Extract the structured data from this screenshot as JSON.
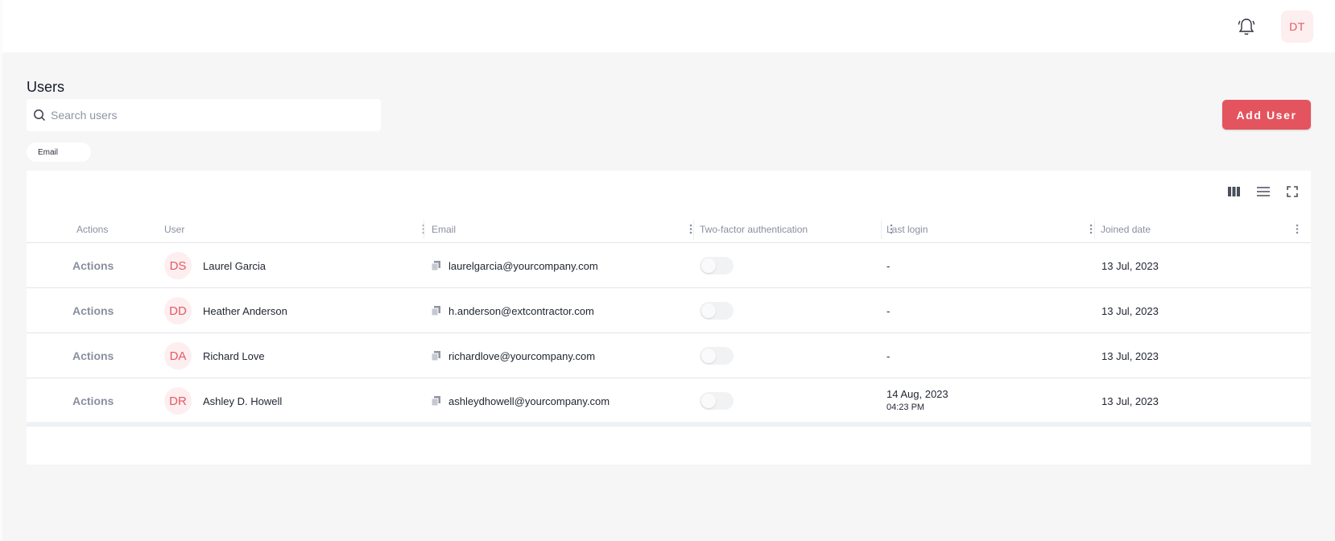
{
  "header": {
    "notification_icon": "bell-icon",
    "user_initials": "DT"
  },
  "page": {
    "title": "Users"
  },
  "search": {
    "placeholder": "Search users",
    "value": ""
  },
  "add_user_label": "Add User",
  "filter_chip": "Email",
  "toolbar_icons": [
    "columns-icon",
    "density-icon",
    "fullscreen-icon"
  ],
  "table": {
    "columns": [
      "Actions",
      "User",
      "Email",
      "Two-factor authentication",
      "Last login",
      "Joined date"
    ],
    "rows": [
      {
        "action": "Actions",
        "initials": "DS",
        "name": "Laurel Garcia",
        "email": "laurelgarcia@yourcompany.com",
        "two_factor": false,
        "last_login_date": "-",
        "last_login_time": "",
        "joined": "13 Jul, 2023"
      },
      {
        "action": "Actions",
        "initials": "DD",
        "name": "Heather Anderson",
        "email": "h.anderson@extcontractor.com",
        "two_factor": false,
        "last_login_date": "-",
        "last_login_time": "",
        "joined": "13 Jul, 2023"
      },
      {
        "action": "Actions",
        "initials": "DA",
        "name": "Richard Love",
        "email": "richardlove@yourcompany.com",
        "two_factor": false,
        "last_login_date": "-",
        "last_login_time": "",
        "joined": "13 Jul, 2023"
      },
      {
        "action": "Actions",
        "initials": "DR",
        "name": "Ashley D. Howell",
        "email": "ashleydhowell@yourcompany.com",
        "two_factor": false,
        "last_login_date": "14 Aug, 2023",
        "last_login_time": "04:23 PM",
        "joined": "13 Jul, 2023"
      }
    ]
  },
  "colors": {
    "accent": "#e3545e",
    "avatar_bg": "#fdeef0",
    "avatar_text": "#e35a64",
    "muted_text": "#8a8fa0"
  }
}
